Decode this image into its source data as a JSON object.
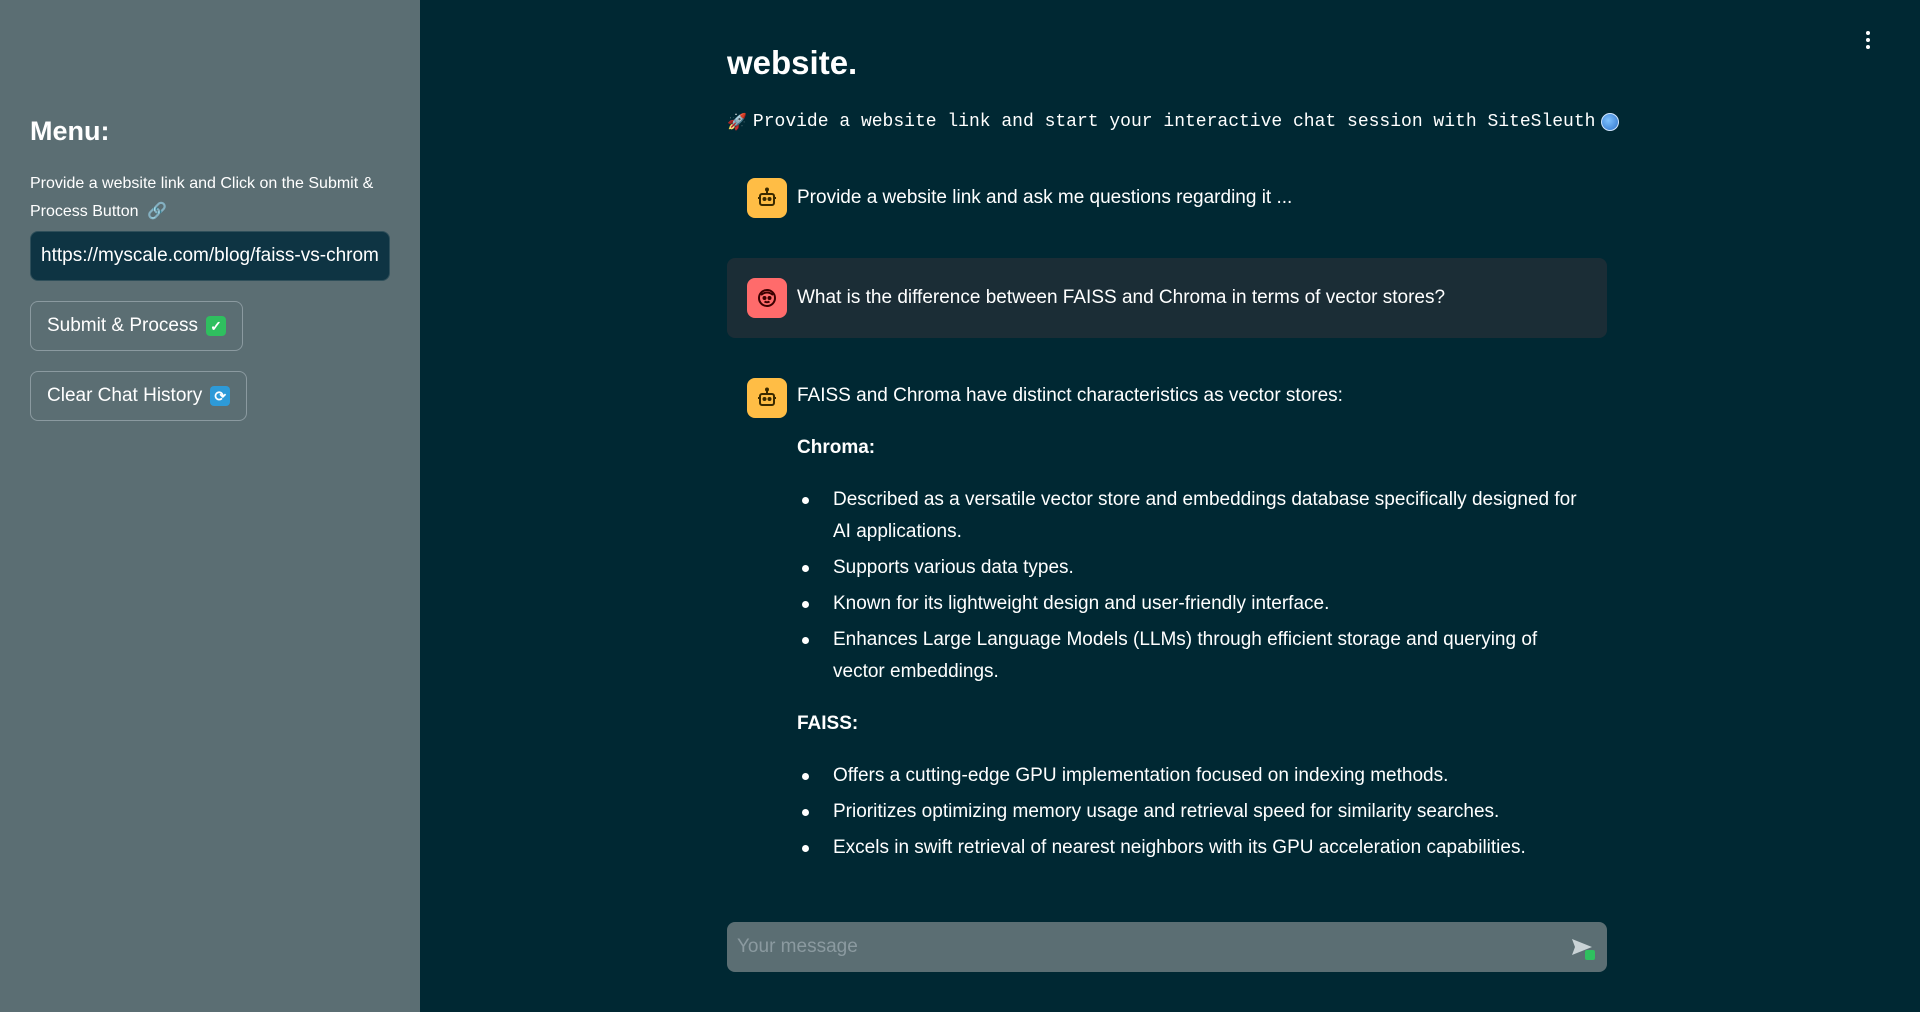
{
  "sidebar": {
    "heading": "Menu:",
    "description": "Provide a website link and Click on the Submit & Process Button",
    "link_icon": "link-icon",
    "url_value": "https://myscale.com/blog/faiss-vs-chroma",
    "submit_label": "Submit & Process",
    "submit_icon": "check-mark-icon",
    "clear_label": "Clear Chat History",
    "clear_icon": "refresh-icon"
  },
  "header": {
    "title": "website.",
    "subtitle": "Provide a website link and start your interactive chat session with SiteSleuth",
    "rocket_icon": "rocket-icon",
    "globe_icon": "globe-icon",
    "menu_icon": "kebab-menu-icon"
  },
  "messages": [
    {
      "role": "assistant",
      "text": "Provide a website link and ask me questions regarding it ..."
    },
    {
      "role": "user",
      "text": "What is the difference between FAISS and Chroma in terms of vector stores?"
    },
    {
      "role": "assistant",
      "intro": "FAISS and Chroma have distinct characteristics as vector stores:",
      "sections": [
        {
          "heading": "Chroma:",
          "bullets": [
            "Described as a versatile vector store and embeddings database specifically designed for AI applications.",
            "Supports various data types.",
            "Known for its lightweight design and user-friendly interface.",
            "Enhances Large Language Models (LLMs) through efficient storage and querying of vector embeddings."
          ]
        },
        {
          "heading": "FAISS:",
          "bullets": [
            "Offers a cutting-edge GPU implementation focused on indexing methods.",
            "Prioritizes optimizing memory usage and retrieval speed for similarity searches.",
            "Excels in swift retrieval of nearest neighbors with its GPU acceleration capabilities."
          ]
        }
      ]
    }
  ],
  "chat_input": {
    "placeholder": "Your message",
    "send_icon": "send-icon"
  },
  "colors": {
    "background": "#002833",
    "sidebar": "#5b6e73",
    "bot_avatar": "#ffbd45",
    "user_avatar": "#ff6b6b"
  }
}
